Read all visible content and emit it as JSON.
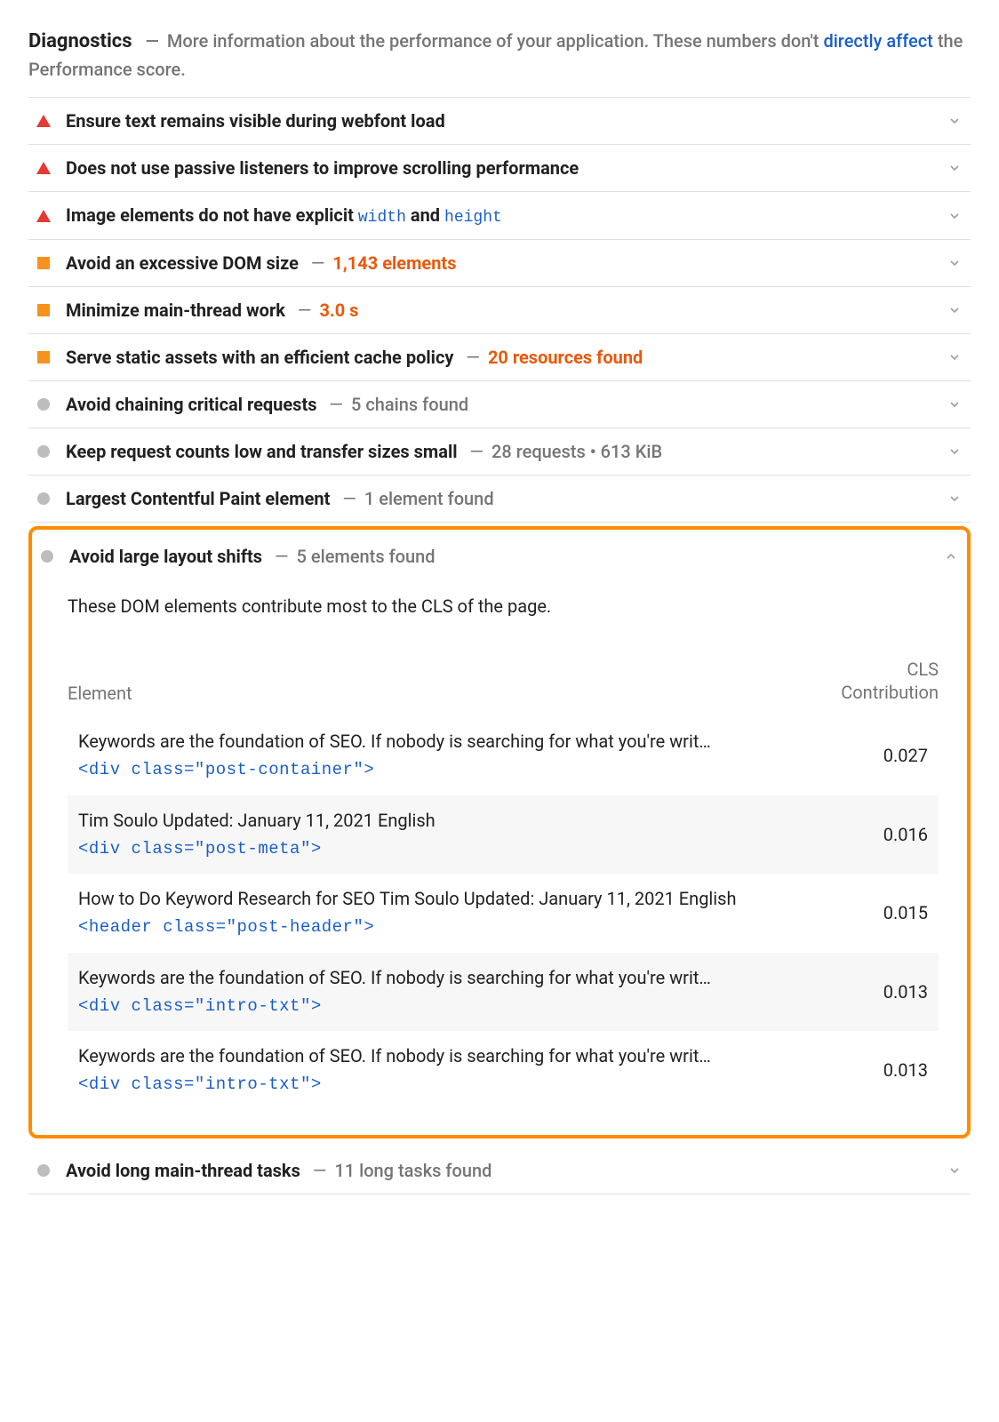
{
  "header": {
    "title": "Diagnostics",
    "desc_before": "More information about the performance of your application. These numbers don't ",
    "desc_link": "directly affect",
    "desc_after": " the Performance score."
  },
  "audits": [
    {
      "icon": "tri-red",
      "title": "Ensure text remains visible during webfont load",
      "detail": "",
      "detail_class": ""
    },
    {
      "icon": "tri-red",
      "title": "Does not use passive listeners to improve scrolling performance",
      "detail": "",
      "detail_class": ""
    },
    {
      "icon": "tri-red",
      "title_html": "Image elements do not have explicit <span class=\"code-inline\">width</span> and <span class=\"code-inline\">height</span>",
      "detail": "",
      "detail_class": ""
    },
    {
      "icon": "sq-orange",
      "title": "Avoid an excessive DOM size",
      "detail": "1,143 elements",
      "detail_class": "detail-orange"
    },
    {
      "icon": "sq-orange",
      "title": "Minimize main-thread work",
      "detail": "3.0 s",
      "detail_class": "detail-orange"
    },
    {
      "icon": "sq-orange",
      "title": "Serve static assets with an efficient cache policy",
      "detail": "20 resources found",
      "detail_class": "detail-orange"
    },
    {
      "icon": "circ-gray",
      "title": "Avoid chaining critical requests",
      "detail": "5 chains found",
      "detail_class": "detail-gray"
    },
    {
      "icon": "circ-gray",
      "title": "Keep request counts low and transfer sizes small",
      "detail": "28 requests • 613 KiB",
      "detail_class": "detail-gray"
    },
    {
      "icon": "circ-gray",
      "title": "Largest Contentful Paint element",
      "detail": "1 element found",
      "detail_class": "detail-gray"
    }
  ],
  "expanded": {
    "icon": "circ-gray",
    "title": "Avoid large layout shifts",
    "detail": "5 elements found",
    "desc": "These DOM elements contribute most to the CLS of the page.",
    "col_element": "Element",
    "col_value": "CLS Contribution",
    "rows": [
      {
        "text": "Keywords are the foundation of SEO. If nobody is searching for what you're writ…",
        "code": "<div class=\"post-container\">",
        "value": "0.027"
      },
      {
        "text": "Tim Soulo Updated: January 11, 2021 English",
        "code": "<div class=\"post-meta\">",
        "value": "0.016"
      },
      {
        "text": "How to Do Keyword Research for SEO Tim Soulo Updated: January 11, 2021 English",
        "code": "<header class=\"post-header\">",
        "value": "0.015"
      },
      {
        "text": "Keywords are the foundation of SEO. If nobody is searching for what you're writ…",
        "code": "<div class=\"intro-txt\">",
        "value": "0.013"
      },
      {
        "text": "Keywords are the foundation of SEO. If nobody is searching for what you're writ…",
        "code": "<div class=\"intro-txt\">",
        "value": "0.013"
      }
    ]
  },
  "last": {
    "icon": "circ-gray",
    "title": "Avoid long main-thread tasks",
    "detail": "11 long tasks found",
    "detail_class": "detail-gray"
  }
}
